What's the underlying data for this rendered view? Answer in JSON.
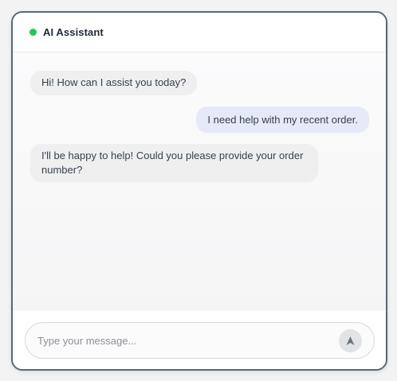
{
  "header": {
    "title": "AI Assistant",
    "status_color": "#22c55e"
  },
  "messages": [
    {
      "role": "assistant",
      "text": "Hi! How can I assist you today?"
    },
    {
      "role": "user",
      "text": "I need help with my recent order."
    },
    {
      "role": "assistant",
      "text": "I'll be happy to help! Could you please provide your order number?"
    }
  ],
  "composer": {
    "placeholder": "Type your message...",
    "value": "",
    "send_icon": "send-arrow-icon"
  }
}
